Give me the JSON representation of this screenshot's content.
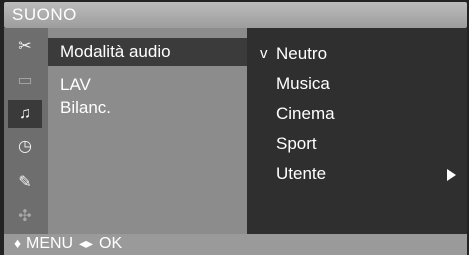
{
  "header": {
    "title": "SUONO"
  },
  "sidebar": {
    "icons": [
      {
        "name": "picture-icon",
        "glyph": "✂"
      },
      {
        "name": "screen-icon",
        "glyph": "▭"
      },
      {
        "name": "sound-icon",
        "glyph": "♫"
      },
      {
        "name": "time-icon",
        "glyph": "◷"
      },
      {
        "name": "option-icon",
        "glyph": "✎"
      },
      {
        "name": "setup-icon",
        "glyph": "✣"
      }
    ]
  },
  "menu": {
    "items": [
      {
        "label": "Modalità audio"
      },
      {
        "label": "LAV"
      },
      {
        "label": "Bilanc."
      }
    ]
  },
  "options": {
    "check_mark": "v",
    "items": [
      {
        "label": "Neutro"
      },
      {
        "label": "Musica"
      },
      {
        "label": "Cinema"
      },
      {
        "label": "Sport"
      },
      {
        "label": "Utente"
      }
    ]
  },
  "footer": {
    "updown_glyph": "♦",
    "menu_label": "MENU",
    "leftright_glyph": "◂▸",
    "ok_label": "OK"
  }
}
